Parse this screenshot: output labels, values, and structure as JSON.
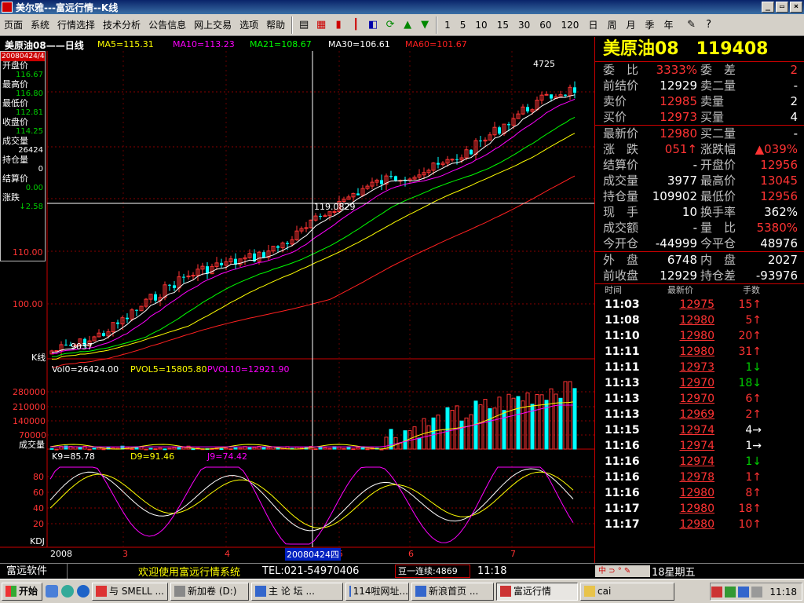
{
  "window": {
    "title": "美尔雅---富远行情--K线",
    "minimize": "_",
    "restore": "▭",
    "close": "×"
  },
  "menu": [
    "页面",
    "系统",
    "行情选择",
    "技术分析",
    "公告信息",
    "网上交易",
    "选项",
    "帮助"
  ],
  "periods": [
    "1",
    "5",
    "10",
    "15",
    "30",
    "60",
    "120",
    "日",
    "周",
    "月",
    "季",
    "年"
  ],
  "chart_header": {
    "title": "美原油08——日线",
    "ma5": "MA5=115.31",
    "ma10": "MA10=113.23",
    "ma21": "MA21=108.67",
    "ma30": "MA30=106.61",
    "ma60": "MA60=101.67"
  },
  "infobox": {
    "date": "20080424/4",
    "items": [
      {
        "k": "开盘价",
        "v": "116.67"
      },
      {
        "k": "最高价",
        "v": "116.80"
      },
      {
        "k": "最低价",
        "v": "112.81"
      },
      {
        "k": "收盘价",
        "v": "114.25"
      },
      {
        "k": "成交量",
        "v": "26424"
      },
      {
        "k": "持仓量",
        "v": "0"
      },
      {
        "k": "结算价",
        "v": "0.00"
      },
      {
        "k": "涨跌",
        "v": "↓2.58"
      }
    ]
  },
  "price_axis": {
    "labels": [
      "110.00",
      "100.00"
    ],
    "kline_label": "K线",
    "annot_high": "4725",
    "annot_low": "9037",
    "crosshair_value": "119.0829"
  },
  "volume_header": {
    "vol": "Vol0=26424.00",
    "pvol5": "PVOL5=15805.80",
    "pvol10": "PVOL10=12921.90"
  },
  "volume_axis": {
    "labels": [
      "280000",
      "210000",
      "140000",
      "70000"
    ],
    "name": "成交量"
  },
  "kdj_header": {
    "k": "K9=85.78",
    "d": "D9=91.46",
    "j": "J9=74.42"
  },
  "kdj_axis": {
    "labels": [
      "80",
      "60",
      "40",
      "20"
    ],
    "name": "KDJ"
  },
  "time_axis": {
    "labels": [
      "2008",
      "3",
      "4",
      "5",
      "6",
      "7"
    ],
    "cursor_date": "20080424四"
  },
  "quote": {
    "name": "美原油08",
    "code": "119408",
    "rows": [
      {
        "k": "委　比",
        "v": "3333%",
        "vc": "#f33",
        "k2": "委　差",
        "v2": "2",
        "v2c": "#f33"
      },
      {
        "k": "前结价",
        "v": "12929",
        "vc": "#fff",
        "k2": "卖二量",
        "v2": "-",
        "v2c": "#fff"
      },
      {
        "k": "卖价",
        "v": "12985",
        "vc": "#f33",
        "k2": "卖量",
        "v2": "2",
        "v2c": "#fff"
      },
      {
        "k": "买价",
        "v": "12973",
        "vc": "#f33",
        "k2": "买量",
        "v2": "4",
        "v2c": "#fff"
      },
      {
        "k": "最新价",
        "v": "12980",
        "vc": "#f33",
        "k2": "买二量",
        "v2": "-",
        "v2c": "#fff"
      },
      {
        "k": "涨　跌",
        "v": "051↑",
        "vc": "#f33",
        "k2": "涨跌幅",
        "v2": "▲039%",
        "v2c": "#f33"
      },
      {
        "k": "结算价",
        "v": "-",
        "vc": "#fff",
        "k2": "开盘价",
        "v2": "12956",
        "v2c": "#f33"
      },
      {
        "k": "成交量",
        "v": "3977",
        "vc": "#fff",
        "k2": "最高价",
        "v2": "13045",
        "v2c": "#f33"
      },
      {
        "k": "持仓量",
        "v": "109902",
        "vc": "#fff",
        "k2": "最低价",
        "v2": "12956",
        "v2c": "#f33"
      },
      {
        "k": "现　手",
        "v": "10",
        "vc": "#fff",
        "k2": "换手率",
        "v2": "362%",
        "v2c": "#fff"
      },
      {
        "k": "成交额",
        "v": "-",
        "vc": "#fff",
        "k2": "量　比",
        "v2": "5380%",
        "v2c": "#f33"
      },
      {
        "k": "今开仓",
        "v": "-44999",
        "vc": "#fff",
        "k2": "今平仓",
        "v2": "48976",
        "v2c": "#fff"
      },
      {
        "k": "外　盘",
        "v": "6748",
        "vc": "#fff",
        "k2": "内　盘",
        "v2": "2027",
        "v2c": "#fff"
      },
      {
        "k": "前收盘",
        "v": "12929",
        "vc": "#fff",
        "k2": "持仓差",
        "v2": "-93976",
        "v2c": "#fff"
      }
    ],
    "tick_header": [
      "时间",
      "最新价",
      "手数"
    ],
    "ticks": [
      {
        "t": "11:03",
        "p": "12975",
        "h": "15↑",
        "c": "#f33"
      },
      {
        "t": "11:08",
        "p": "12980",
        "h": "5↑",
        "c": "#f33"
      },
      {
        "t": "11:10",
        "p": "12980",
        "h": "20↑",
        "c": "#f33"
      },
      {
        "t": "11:11",
        "p": "12980",
        "h": "31↑",
        "c": "#f33"
      },
      {
        "t": "11:11",
        "p": "12973",
        "h": "1↓",
        "c": "#0c0"
      },
      {
        "t": "11:13",
        "p": "12970",
        "h": "18↓",
        "c": "#0c0"
      },
      {
        "t": "11:13",
        "p": "12970",
        "h": "6↑",
        "c": "#f33"
      },
      {
        "t": "11:13",
        "p": "12969",
        "h": "2↑",
        "c": "#f33"
      },
      {
        "t": "11:15",
        "p": "12974",
        "h": "4→",
        "c": "#fff"
      },
      {
        "t": "11:16",
        "p": "12974",
        "h": "1→",
        "c": "#fff"
      },
      {
        "t": "11:16",
        "p": "12974",
        "h": "1↓",
        "c": "#0c0"
      },
      {
        "t": "11:16",
        "p": "12978",
        "h": "1↑",
        "c": "#f33"
      },
      {
        "t": "11:16",
        "p": "12980",
        "h": "8↑",
        "c": "#f33"
      },
      {
        "t": "11:17",
        "p": "12980",
        "h": "18↑",
        "c": "#f33"
      },
      {
        "t": "11:17",
        "p": "12980",
        "h": "10↑",
        "c": "#f33"
      }
    ]
  },
  "statusbar": {
    "brand": "富远软件",
    "welcome": "欢迎使用富远行情系统",
    "tel": "TEL:021-54970406",
    "ticker": "豆一连续:4869",
    "clock": "11:18",
    "day": "18星期五",
    "ime": "中 ⊃ ° ✎"
  },
  "taskbar": {
    "start": "开始",
    "tasks": [
      {
        "label": "与 SMELL ...",
        "active": false
      },
      {
        "label": "新加卷 (D:)",
        "active": false
      },
      {
        "label": "主 论 坛 ...",
        "active": false
      },
      {
        "label": "114啦网址...",
        "active": false
      },
      {
        "label": "新浪首页 ...",
        "active": false
      },
      {
        "label": "富远行情",
        "active": true
      },
      {
        "label": "cai",
        "active": false
      }
    ],
    "clock": "11:18"
  },
  "colors": {
    "up": "#f33",
    "down": "#0ff",
    "ma5": "#ffffff",
    "ma10": "#ff00ff",
    "ma21": "#00ff00",
    "ma30": "#ffff00",
    "ma60": "#ff2020"
  }
}
